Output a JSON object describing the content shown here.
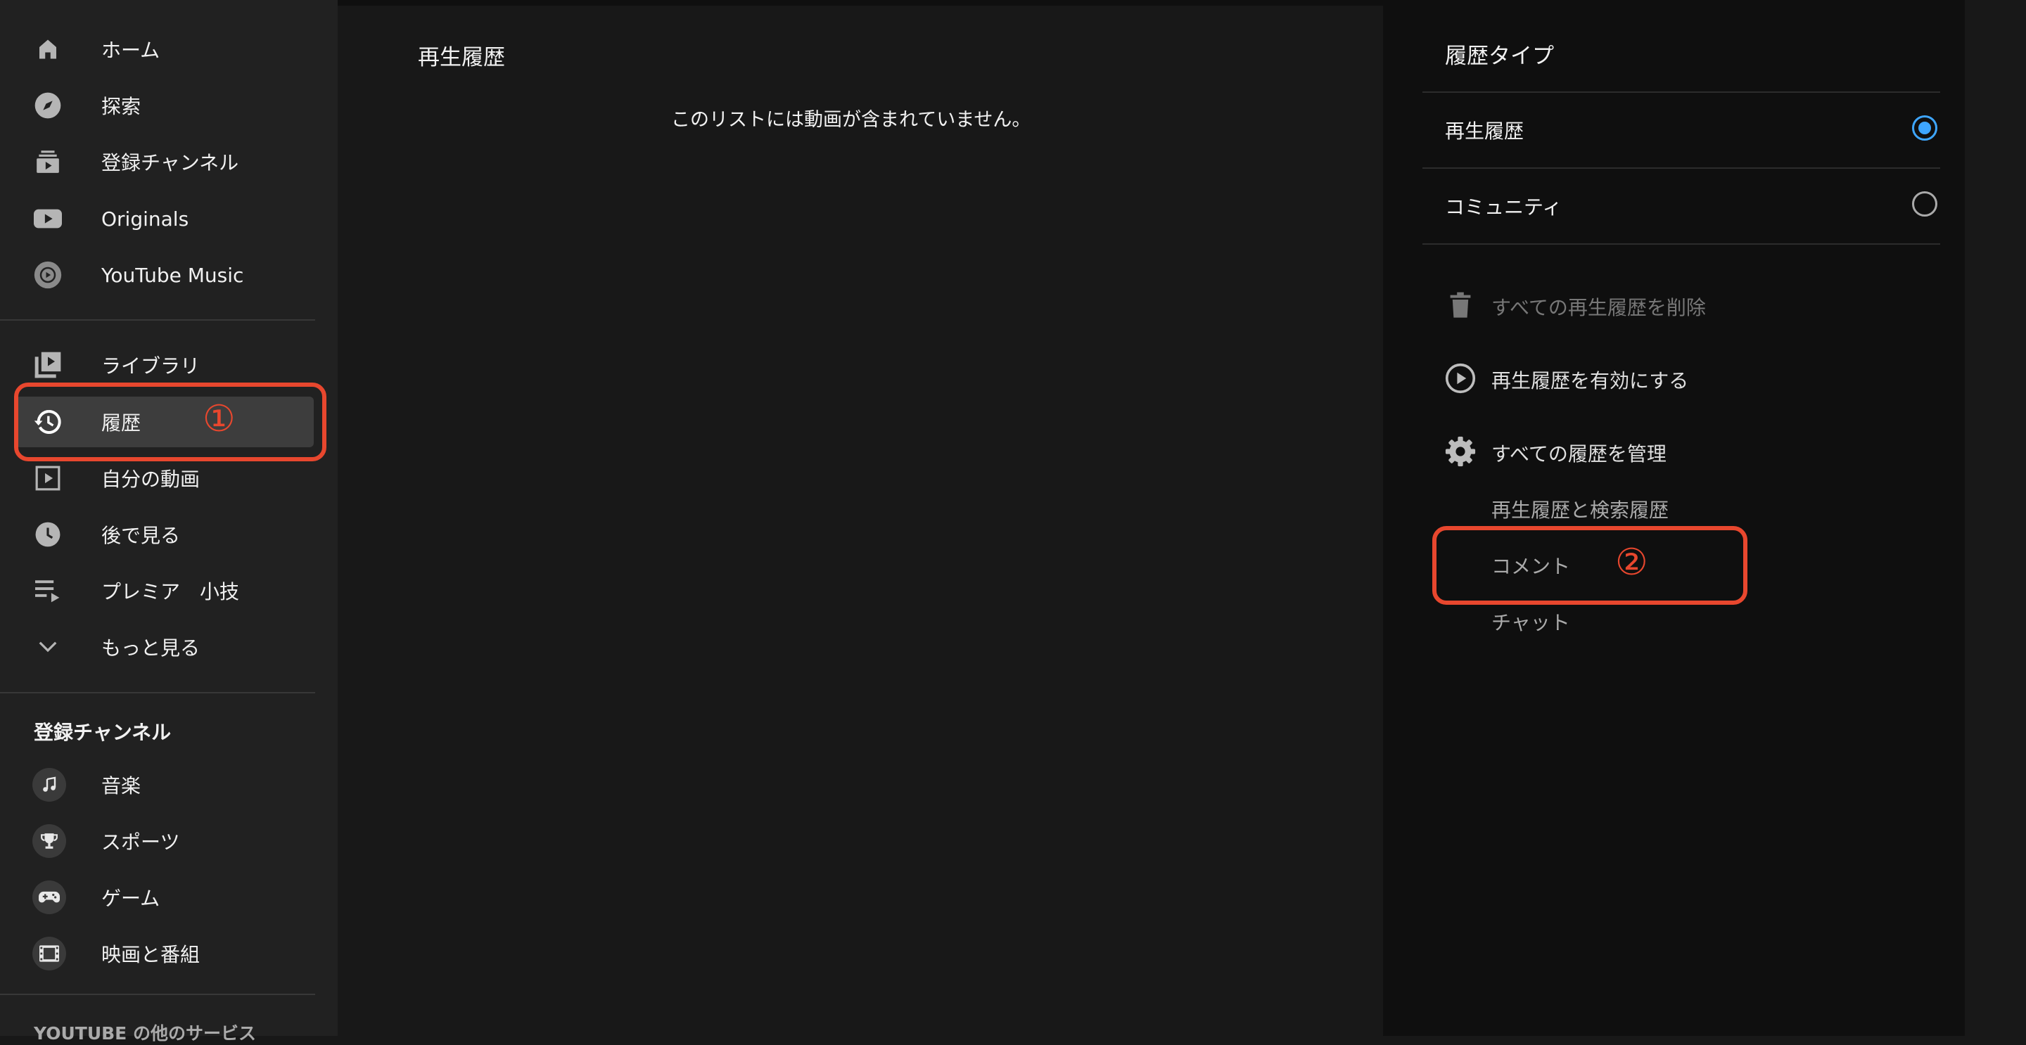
{
  "sidebar": {
    "main_items": [
      {
        "label": "ホーム",
        "icon": "home-icon"
      },
      {
        "label": "探索",
        "icon": "compass-icon"
      },
      {
        "label": "登録チャンネル",
        "icon": "subscriptions-icon"
      },
      {
        "label": "Originals",
        "icon": "originals-icon"
      },
      {
        "label": "YouTube Music",
        "icon": "music-play-icon"
      }
    ],
    "library_items": [
      {
        "label": "ライブラリ",
        "icon": "library-icon"
      },
      {
        "label": "履歴",
        "icon": "history-icon",
        "active": true
      },
      {
        "label": "自分の動画",
        "icon": "my-videos-icon"
      },
      {
        "label": "後で見る",
        "icon": "clock-icon"
      },
      {
        "label": "プレミア　小技",
        "icon": "playlist-icon"
      },
      {
        "label": "もっと見る",
        "icon": "chevron-down-icon"
      }
    ],
    "subscriptions_title": "登録チャンネル",
    "channels": [
      {
        "label": "音楽",
        "icon": "music-note-icon"
      },
      {
        "label": "スポーツ",
        "icon": "trophy-icon"
      },
      {
        "label": "ゲーム",
        "icon": "gamepad-icon"
      },
      {
        "label": "映画と番組",
        "icon": "film-icon"
      }
    ],
    "more_services_title": "YOUTUBE の他のサービス"
  },
  "main": {
    "title": "再生履歴",
    "empty_message": "このリストには動画が含まれていません。"
  },
  "panel": {
    "title": "履歴タイプ",
    "history_types": [
      {
        "label": "再生履歴",
        "selected": true
      },
      {
        "label": "コミュニティ",
        "selected": false
      }
    ],
    "actions": [
      {
        "label": "すべての再生履歴を削除",
        "icon": "trash-icon",
        "disabled": true
      },
      {
        "label": "再生履歴を有効にする",
        "icon": "play-circle-icon",
        "disabled": false
      },
      {
        "label": "すべての履歴を管理",
        "icon": "gear-icon",
        "disabled": false
      }
    ],
    "manage_links": [
      "再生履歴と検索履歴",
      "コメント",
      "チャット"
    ]
  },
  "annotations": {
    "marker_1": "①",
    "marker_2": "②",
    "color": "#e8472e"
  },
  "colors": {
    "accent": "#3ea6ff",
    "sidebar_bg": "#212121",
    "main_bg": "#181818",
    "panel_bg": "#0f0f0f"
  }
}
